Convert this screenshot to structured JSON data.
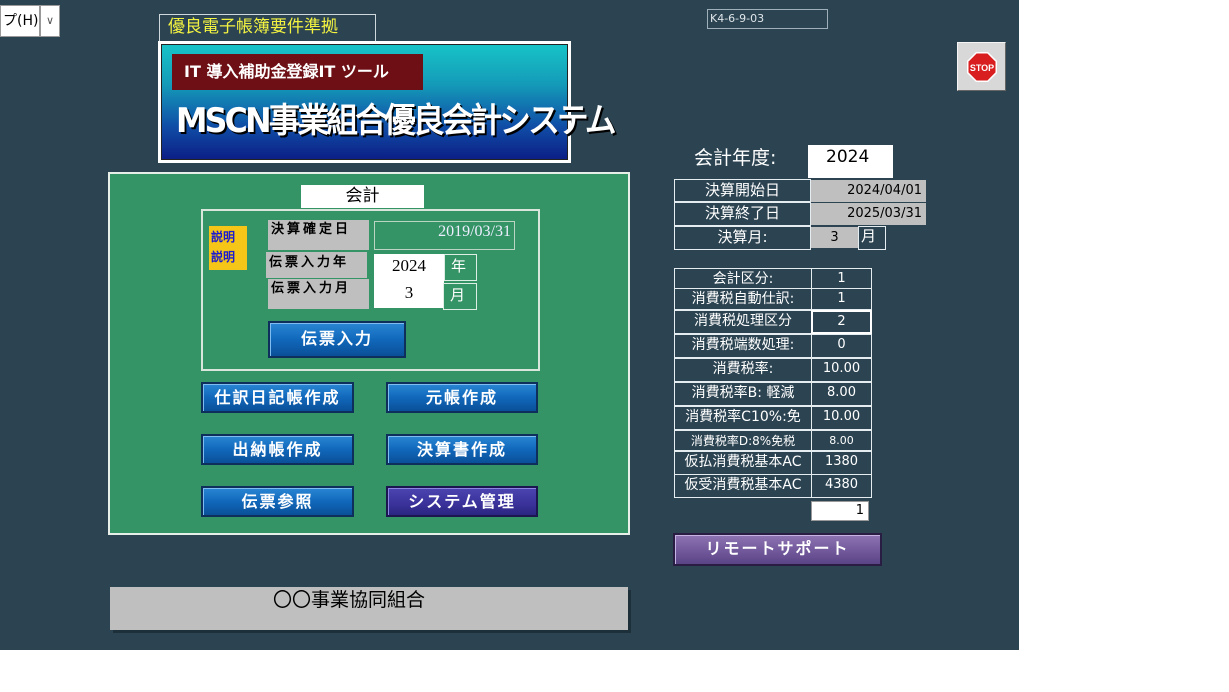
{
  "menu": {
    "help_label": "プ(H)",
    "dropdown_glyph": "∨"
  },
  "header": {
    "denchou_label": "優良電子帳簿要件準拠",
    "form_code": "K4-6-9-03",
    "stop_label": "STOP"
  },
  "logo": {
    "subtitle": "IT 導入補助金登録IT ツール",
    "title": "MSCN事業組合優良会計システム"
  },
  "main": {
    "section_title": "会計",
    "setsumei_1": "説明",
    "setsumei_2": "説明",
    "kettei_label": "決算確定日",
    "kettei_value": "2019/03/31",
    "nen_label": "伝票入力年",
    "nen_value": "2024",
    "nen_unit": "年",
    "tsuki_label": "伝票入力月",
    "tsuki_value": "3",
    "tsuki_unit": "月",
    "buttons": {
      "denpyo_nyuryoku": "伝票入力",
      "shiwake": "仕訳日記帳作成",
      "motocho": "元帳作成",
      "suitocho": "出納帳作成",
      "kessansho": "決算書作成",
      "sansho": "伝票参照",
      "system": "システム管理"
    },
    "org_name": "〇〇事業協同組合"
  },
  "fiscal": {
    "year_label": "会計年度:",
    "year_value": "2024",
    "start_label": "決算開始日",
    "start_value": "2024/04/01",
    "end_label": "決算終了日",
    "end_value": "2025/03/31",
    "month_label": "決算月:",
    "month_value": "3",
    "month_unit": "月"
  },
  "settings": [
    {
      "label": "会計区分:",
      "value": "1"
    },
    {
      "label": "消費税自動仕訳:",
      "value": "1"
    },
    {
      "label": "消費税処理区分",
      "value": "2"
    },
    {
      "label": "消費税端数処理:",
      "value": "0"
    },
    {
      "label": "消費税率:",
      "value": "10.00"
    },
    {
      "label": "消費税率B: 軽減",
      "value": "8.00"
    },
    {
      "label": "消費税率C10%:免",
      "value": "10.00"
    },
    {
      "label": "消費税率D:8%免税",
      "value": "8.00"
    },
    {
      "label": "仮払消費税基本AC",
      "value": "1380"
    },
    {
      "label": "仮受消費税基本AC",
      "value": "4380"
    }
  ],
  "small_box_value": "1",
  "remote_button": "リモートサポート",
  "colors": {
    "background": "#2c4452",
    "panel_green": "#349466",
    "button_blue": "#1168bb",
    "button_purple": "#3a329a",
    "remote_purple": "#6f5699",
    "logo_label_red": "#6d0f14",
    "stop_red": "#d81e1e"
  }
}
